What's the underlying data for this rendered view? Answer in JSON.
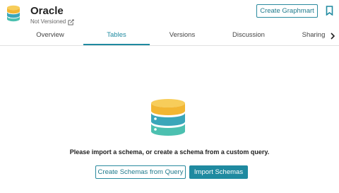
{
  "header": {
    "title": "Oracle",
    "version_status": "Not Versioned",
    "create_graphmart_label": "Create Graphmart"
  },
  "tabs": [
    {
      "label": "Overview",
      "active": false
    },
    {
      "label": "Tables",
      "active": true
    },
    {
      "label": "Versions",
      "active": false
    },
    {
      "label": "Discussion",
      "active": false
    },
    {
      "label": "Sharing",
      "active": false
    }
  ],
  "empty_state": {
    "message": "Please import a schema, or create a schema from a custom query.",
    "secondary_button": "Create Schemas from Query",
    "primary_button": "Import Schemas"
  },
  "colors": {
    "accent": "#1f8aa0",
    "db_top": "#f2b632",
    "db_middle": "#3aa6b9",
    "db_bottom": "#4cc0b0"
  },
  "icons": {
    "logo": "database-icon",
    "edit": "external-edit-icon",
    "bookmark": "bookmark-icon",
    "tabs_next": "chevron-right-icon",
    "empty_state": "database-icon"
  }
}
